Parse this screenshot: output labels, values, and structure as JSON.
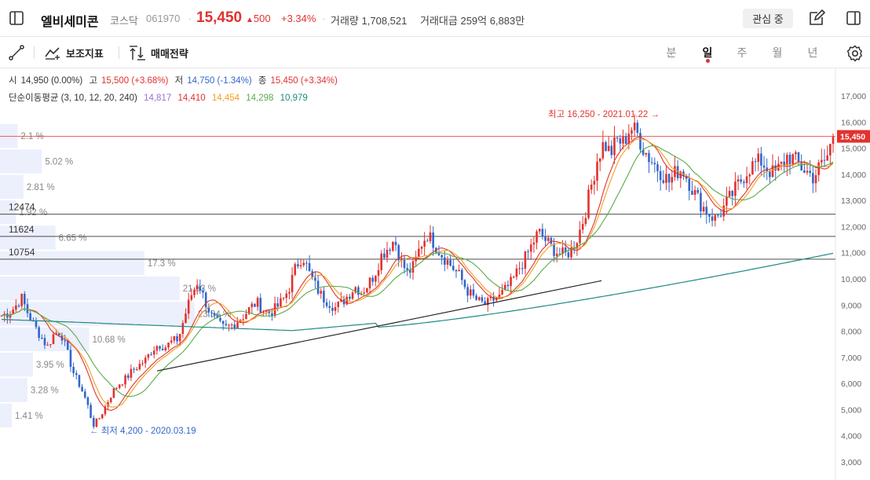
{
  "header": {
    "stock_name": "엘비세미콘",
    "market": "코스닥",
    "code": "061970",
    "price": "15,450",
    "change": "500",
    "change_pct": "+3.34%",
    "volume_label": "거래량",
    "volume": "1,708,521",
    "amount_label": "거래대금",
    "amount": "259억 6,883만",
    "watch_label": "관심 중"
  },
  "toolbar": {
    "indicator_label": "보조지표",
    "strategy_label": "매매전략",
    "periods": [
      "분",
      "일",
      "주",
      "월",
      "년"
    ],
    "active_period": "일"
  },
  "ohlc": {
    "open_label": "시",
    "open": "14,950 (0.00%)",
    "high_label": "고",
    "high": "15,500 (+3.68%)",
    "low_label": "저",
    "low": "14,750 (-1.34%)",
    "close_label": "종",
    "close": "15,450 (+3.34%)"
  },
  "ma": {
    "label": "단순이동평균 (3, 10, 12, 20, 240)",
    "values": [
      {
        "value": "14,817",
        "color": "#9b6fd6"
      },
      {
        "value": "14,410",
        "color": "#e2322f"
      },
      {
        "value": "14,454",
        "color": "#f0a020"
      },
      {
        "value": "14,298",
        "color": "#5aaa4a"
      },
      {
        "value": "10,979",
        "color": "#1f8a80"
      }
    ]
  },
  "chart_data": {
    "type": "candlestick",
    "y_axis": {
      "min": 3000,
      "max": 17000,
      "ticks": [
        "17,000",
        "16,000",
        "15,000",
        "14,000",
        "13,000",
        "12,000",
        "11,000",
        "10,000",
        "9,000",
        "8,000",
        "7,000",
        "6,000",
        "5,000",
        "4,000",
        "3,000"
      ]
    },
    "current_price_tag": "15,450",
    "current_price": 15450,
    "high_annotation": "최고 16,250 - 2021.01.22",
    "low_annotation": "최저 4,200 - 2020.03.19",
    "horizontal_levels": [
      {
        "label": "12474",
        "value": 12474
      },
      {
        "label": "11624",
        "value": 11624
      },
      {
        "label": "10754",
        "value": 10754
      }
    ],
    "volume_profile": [
      {
        "pct": "2.1 %",
        "value": 2.1
      },
      {
        "pct": "5.02 %",
        "value": 5.02
      },
      {
        "pct": "2.81 %",
        "value": 2.81
      },
      {
        "pct": "1.92 %",
        "value": 1.92
      },
      {
        "pct": "6.65 %",
        "value": 6.65
      },
      {
        "pct": "17.3 %",
        "value": 17.3
      },
      {
        "pct": "21.53 %",
        "value": 21.53
      },
      {
        "pct": "23.34 %",
        "value": 23.34
      },
      {
        "pct": "10.68 %",
        "value": 10.68
      },
      {
        "pct": "3.95 %",
        "value": 3.95
      },
      {
        "pct": "3.28 %",
        "value": 3.28
      },
      {
        "pct": "1.41 %",
        "value": 1.41
      }
    ],
    "price_path": [
      8600,
      8700,
      8900,
      9300,
      8700,
      8200,
      7800,
      7400,
      7900,
      8000,
      7200,
      6400,
      5900,
      5300,
      4400,
      4700,
      5200,
      5700,
      6000,
      6200,
      6500,
      6700,
      6900,
      7300,
      7500,
      7400,
      7600,
      7700,
      8600,
      9400,
      9900,
      9200,
      8600,
      8300,
      8100,
      8200,
      8400,
      8600,
      8900,
      9100,
      8800,
      8700,
      8900,
      9200,
      9700,
      10500,
      10900,
      10200,
      9700,
      9300,
      9100,
      8900,
      9100,
      9400,
      9700,
      9500,
      9800,
      10200,
      10900,
      11200,
      11500,
      10700,
      10200,
      10500,
      11300,
      11700,
      11400,
      11000,
      10700,
      10400,
      10100,
      9600,
      9300,
      9100,
      9000,
      9200,
      9300,
      9600,
      9900,
      10400,
      10800,
      11300,
      11800,
      11500,
      11200,
      11000,
      10900,
      11100,
      11600,
      12400,
      13500,
      14600,
      15200,
      14800,
      15300,
      15200,
      15800,
      15600,
      15000,
      14600,
      14300,
      14000,
      13700,
      14100,
      14200,
      13700,
      13200,
      12800,
      12500,
      12300,
      12600,
      13000,
      13400,
      13800,
      14200,
      14400,
      14500,
      14200,
      14000,
      14300,
      14700,
      14600,
      14300,
      14100,
      13900,
      14300,
      14600,
      15450
    ]
  }
}
